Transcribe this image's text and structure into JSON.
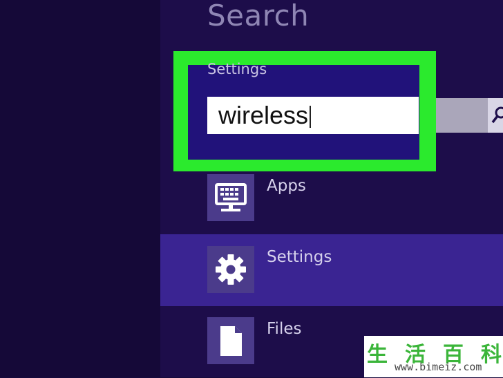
{
  "header": {
    "title": "Search"
  },
  "search": {
    "scope": "Settings",
    "query": "wireless"
  },
  "results": [
    {
      "label": "Apps",
      "icon": "monitor-keyboard-icon"
    },
    {
      "label": "Settings",
      "icon": "gear-icon"
    },
    {
      "label": "Files",
      "icon": "document-icon"
    }
  ],
  "watermark": {
    "characters": [
      "生",
      "活",
      "百",
      "科"
    ],
    "url": "www.bimeiz.com"
  }
}
